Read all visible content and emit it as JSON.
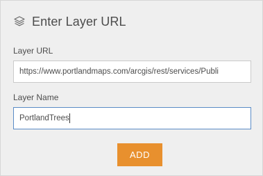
{
  "header": {
    "icon": "layers-icon",
    "title": "Enter Layer URL"
  },
  "form": {
    "url_label": "Layer URL",
    "url_value": "https://www.portlandmaps.com/arcgis/rest/services/Publi",
    "name_label": "Layer Name",
    "name_value": "PortlandTrees"
  },
  "actions": {
    "add_label": "ADD"
  },
  "colors": {
    "accent": "#e8902e",
    "focus_border": "#5a8bc6",
    "panel_bg": "#efefef"
  }
}
